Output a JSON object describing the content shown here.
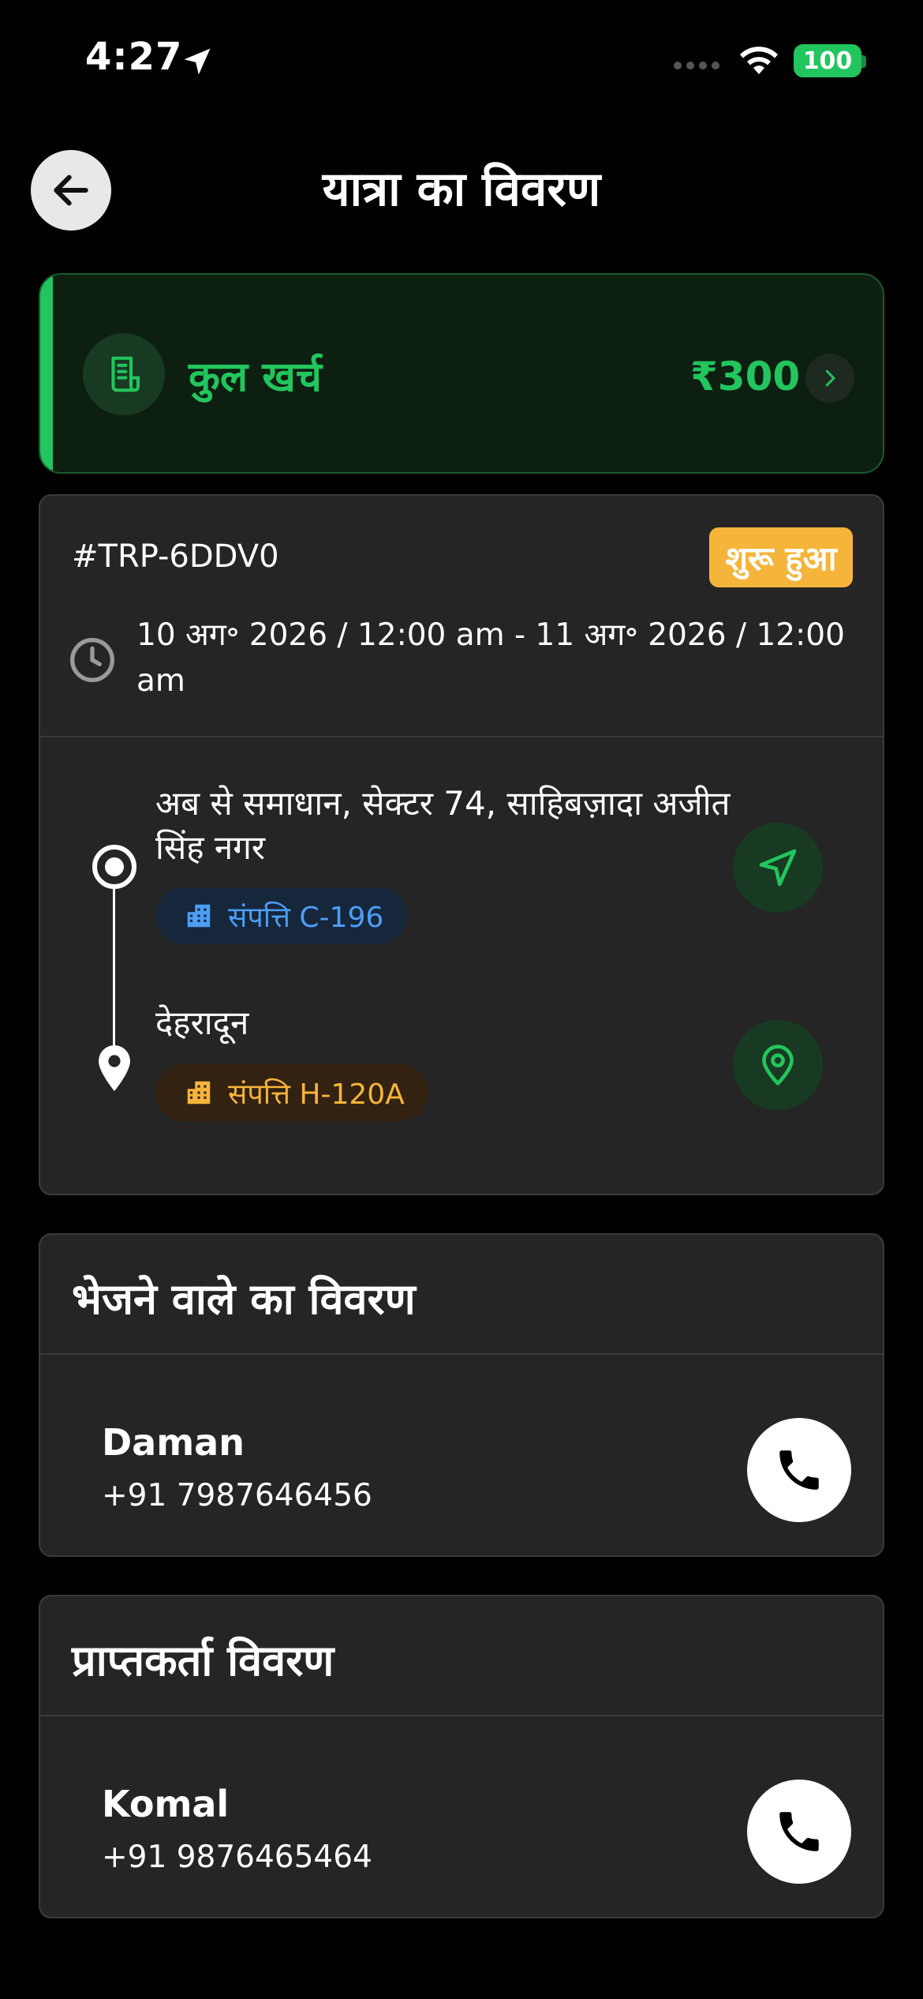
{
  "status_bar": {
    "time": "4:27",
    "battery": "100",
    "icons": [
      "location-arrow-icon",
      "signal-dots-icon",
      "wifi-icon",
      "battery-icon"
    ]
  },
  "header": {
    "title": "यात्रा का विवरण",
    "back_icon": "arrow-left-icon"
  },
  "expense": {
    "label": "कुल खर्च",
    "amount": "₹300",
    "icon": "receipt-icon",
    "chevron_icon": "chevron-right-icon"
  },
  "trip": {
    "id": "#TRP-6DDV0",
    "status": "शुरू हुआ",
    "dates": "10 अग॰ 2026 / 12:00 am - 11 अग॰ 2026 / 12:00 am",
    "origin": {
      "address": "अब से समाधान, सेक्टर 74, साहिबज़ादा अजीत सिंह नगर",
      "property": "संपत्ति C-196"
    },
    "destination": {
      "address": "देहरादून",
      "property": "संपत्ति H-120A"
    }
  },
  "sender": {
    "title": "भेजने वाले का विवरण",
    "name": "Daman",
    "phone": "+91 7987646456"
  },
  "receiver": {
    "title": "प्राप्तकर्ता विवरण",
    "name": "Komal",
    "phone": "+91 9876465464"
  },
  "colors": {
    "accent_green": "#22c55e",
    "status_orange": "#f5b53a",
    "property_blue": "#4d9ef5",
    "card_bg": "#252525"
  }
}
